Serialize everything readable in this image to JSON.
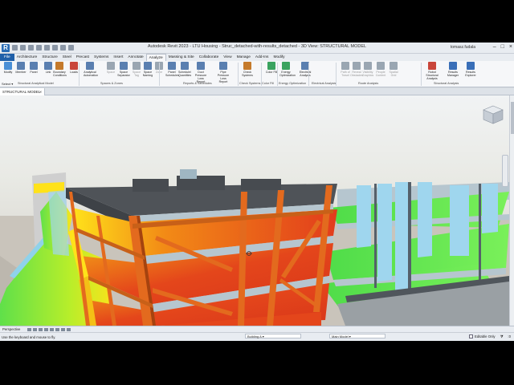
{
  "window": {
    "title": "Autodesk Revit 2023 - LTU Housing - Struc_detached-with-results_detached - 3D View: STRUCTURAL MODEL",
    "user": "tomasz.fudala",
    "app_icon_letter": "R"
  },
  "ribbon_tabs": [
    "File",
    "Architecture",
    "Structure",
    "Steel",
    "Precast",
    "Systems",
    "Insert",
    "Annotate",
    "Analyze",
    "Massing & Site",
    "Collaborate",
    "View",
    "Manage",
    "Add-Ins",
    "Modify"
  ],
  "active_tab": "Analyze",
  "tools": [
    {
      "label": "Modify",
      "color": "#4a8fd6"
    },
    {
      "label": "Member",
      "color": "#5a7fb0"
    },
    {
      "label": "Panel",
      "color": "#5a7fb0"
    },
    {
      "label": "Link",
      "color": "#5a7fb0"
    },
    {
      "label": "Boundary Conditions",
      "color": "#c57a2b"
    },
    {
      "label": "Loads",
      "color": "#c9453a"
    },
    {
      "label": "Analytical Automation",
      "color": "#5a7fb0"
    },
    {
      "label": "Space",
      "color": "#9aa6b2",
      "dim": true
    },
    {
      "label": "Space Separator",
      "color": "#5a7fb0"
    },
    {
      "label": "Space Tag",
      "color": "#9aa6b2",
      "dim": true
    },
    {
      "label": "Space Naming",
      "color": "#5a7fb0"
    },
    {
      "label": "Zone",
      "color": "#9aa6b2",
      "dim": true
    },
    {
      "label": "Panel Schedules",
      "color": "#5a7fb0"
    },
    {
      "label": "Schedule/ Quantities",
      "color": "#5a7fb0"
    },
    {
      "label": "Duct Pressure Loss Report",
      "color": "#5a7fb0"
    },
    {
      "label": "Pipe Pressure Loss Report",
      "color": "#5a7fb0"
    },
    {
      "label": "Check Systems",
      "color": "#c57a2b"
    },
    {
      "label": "Color Fill",
      "color": "#3aa35f"
    },
    {
      "label": "Energy Optimization",
      "color": "#3aa35f"
    },
    {
      "label": "Electrical Analysis",
      "color": "#5a7fb0"
    },
    {
      "label": "Path of Travel",
      "color": "#9aa6b2",
      "dim": true
    },
    {
      "label": "Reveal Obstacles",
      "color": "#9aa6b2",
      "dim": true
    },
    {
      "label": "Visibility Graphics",
      "color": "#9aa6b2",
      "dim": true
    },
    {
      "label": "People Content",
      "color": "#9aa6b2",
      "dim": true
    },
    {
      "label": "Spatial Grid",
      "color": "#9aa6b2",
      "dim": true
    },
    {
      "label": "Robot Structural Analysis",
      "color": "#c9453a"
    },
    {
      "label": "Results Manager",
      "color": "#3a6fb8"
    },
    {
      "label": "Results Explorer",
      "color": "#3a6fb8"
    }
  ],
  "groups": [
    "Structural Analytical Model",
    "Spaces & Zones",
    "Reports & Schedules",
    "Check Systems",
    "Color Fill",
    "Energy Optimization",
    "Electrical Analysis",
    "Route Analysis",
    "Structural Analysis"
  ],
  "select_label": "Select",
  "view_tab": {
    "label": "STRUCTURAL MODEL",
    "close": "×"
  },
  "view_control": {
    "perspective": "Perspective",
    "building": "Building A",
    "model": "Main Model"
  },
  "status": {
    "message": "Use the keyboard and mouse to fly.",
    "editable_only": "Editable Only",
    "coords": ":0"
  },
  "colors": {
    "steel": "#e36a1e",
    "concrete": "#b6c6cf",
    "hot": "#e23c1c",
    "cool": "#5fe04a",
    "glass": "#9fd6ee"
  }
}
